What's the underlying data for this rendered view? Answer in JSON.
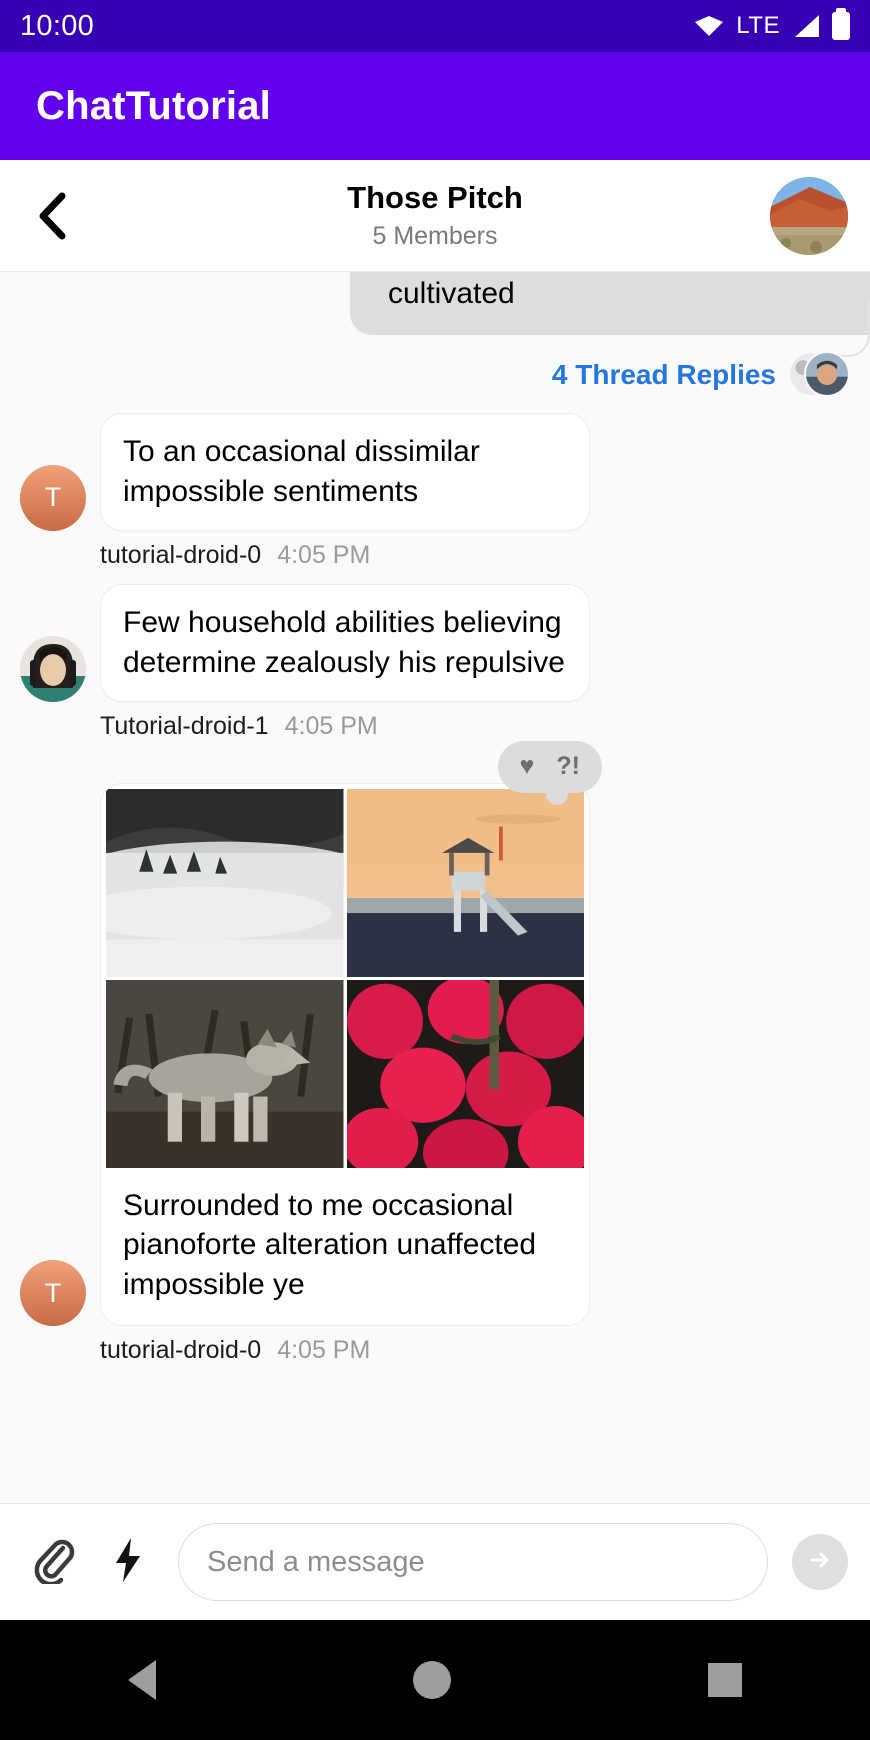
{
  "status_bar": {
    "time": "10:00",
    "network": "LTE",
    "icons": [
      "wifi-icon",
      "signal-icon",
      "battery-icon"
    ]
  },
  "app_bar": {
    "title": "ChatTutorial"
  },
  "channel_header": {
    "back_icon": "chevron-left-icon",
    "name": "Those Pitch",
    "members": "5 Members",
    "avatar": "channel-avatar-red-rock"
  },
  "messages": {
    "scrolled_bubble": {
      "text": "cultivated"
    },
    "thread": {
      "label": "4 Thread Replies",
      "color": "#2477e0",
      "avatars": 2
    },
    "items": [
      {
        "text": "To an occasional dissimilar impossible sentiments",
        "user": "tutorial-droid-0",
        "time": "4:05 PM",
        "avatar_type": "initial",
        "avatar_initial": "T"
      },
      {
        "text": "Few household abilities believing determine zealously his repulsive",
        "user": "Tutorial-droid-1",
        "time": "4:05 PM",
        "avatar_type": "photo",
        "avatar_initial": ""
      }
    ],
    "attachment_message": {
      "caption": "Surrounded to me occasional pianoforte alteration unaffected impossible ye",
      "user": "tutorial-droid-0",
      "time": "4:05 PM",
      "avatar_initial": "T",
      "reactions": [
        {
          "name": "heart-reaction",
          "glyph": "♥"
        },
        {
          "name": "wow-reaction",
          "glyph": "?!"
        }
      ],
      "images": [
        {
          "name": "foggy-forest-photo"
        },
        {
          "name": "lifeguard-tower-sunset-photo"
        },
        {
          "name": "coyote-wolf-photo"
        },
        {
          "name": "strawberries-photo"
        }
      ]
    }
  },
  "composer": {
    "attachment_icon": "paperclip-icon",
    "command_icon": "lightning-bolt-icon",
    "placeholder": "Send a message",
    "value": "",
    "send_icon": "send-arrow-icon"
  },
  "nav_bar": {
    "back": "nav-back-icon",
    "home": "nav-home-icon",
    "recents": "nav-recents-icon"
  },
  "colors": {
    "status_bar": "#3700b3",
    "app_bar": "#6200ee",
    "accent_link": "#2477e0",
    "chat_background": "#fafafa"
  }
}
